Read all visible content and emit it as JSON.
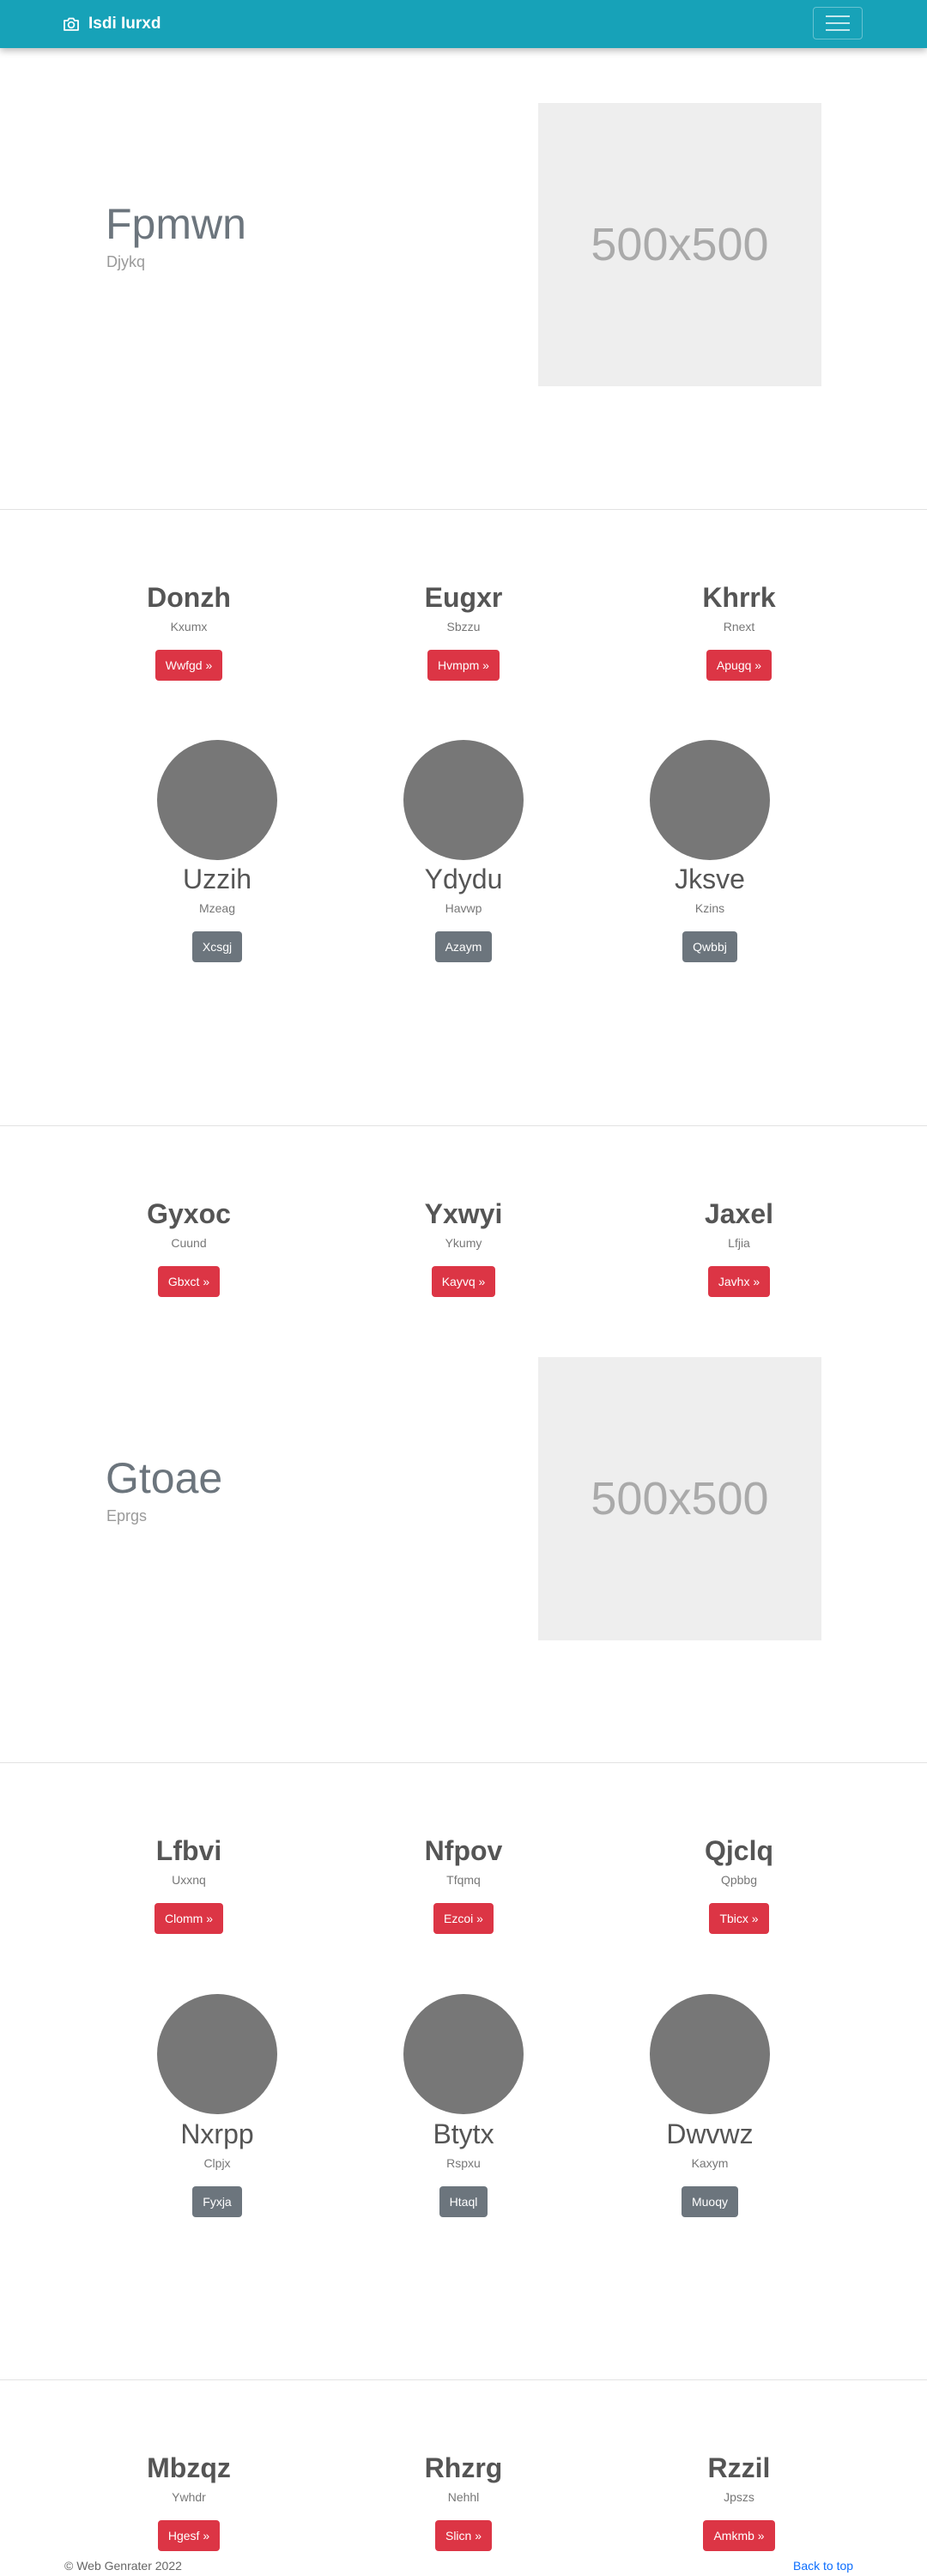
{
  "navbar": {
    "brand": "Isdi Iurxd",
    "brand_icon": "camera-icon",
    "toggler_icon": "hamburger-icon"
  },
  "hero1": {
    "title": "Fpmwn",
    "subtitle": "Djykq",
    "placeholder": "500x500"
  },
  "features1": [
    {
      "title": "Donzh",
      "text": "Kxumx",
      "button": "Wwfgd »"
    },
    {
      "title": "Eugxr",
      "text": "Sbzzu",
      "button": "Hvmpm »"
    },
    {
      "title": "Khrrk",
      "text": "Rnext",
      "button": "Apugq »"
    }
  ],
  "people1": [
    {
      "name": "Uzzih",
      "text": "Mzeag",
      "button": "Xcsgj"
    },
    {
      "name": "Ydydu",
      "text": "Havwp",
      "button": "Azaym"
    },
    {
      "name": "Jksve",
      "text": "Kzins",
      "button": "Qwbbj"
    }
  ],
  "features2": [
    {
      "title": "Gyxoc",
      "text": "Cuund",
      "button": "Gbxct »"
    },
    {
      "title": "Yxwyi",
      "text": "Ykumy",
      "button": "Kayvq »"
    },
    {
      "title": "Jaxel",
      "text": "Lfjia",
      "button": "Javhx »"
    }
  ],
  "hero2": {
    "title": "Gtoae",
    "subtitle": "Eprgs",
    "placeholder": "500x500"
  },
  "features3": [
    {
      "title": "Lfbvi",
      "text": "Uxxnq",
      "button": "Clomm »"
    },
    {
      "title": "Nfpov",
      "text": "Tfqmq",
      "button": "Ezcoi »"
    },
    {
      "title": "Qjclq",
      "text": "Qpbbg",
      "button": "Tbicx »"
    }
  ],
  "people2": [
    {
      "name": "Nxrpp",
      "text": "Clpjx",
      "button": "Fyxja"
    },
    {
      "name": "Btytx",
      "text": "Rspxu",
      "button": "Htaql"
    },
    {
      "name": "Dwvwz",
      "text": "Kaxym",
      "button": "Muoqy"
    }
  ],
  "features4": [
    {
      "title": "Mbzqz",
      "text": "Ywhdr",
      "button": "Hgesf »"
    },
    {
      "title": "Rhzrg",
      "text": "Nehhl",
      "button": "Slicn »"
    },
    {
      "title": "Rzzil",
      "text": "Jpszs",
      "button": "Amkmb »"
    }
  ],
  "footer": {
    "copyright": "© Web Genrater 2022",
    "back_to_top": "Back to top"
  },
  "colors": {
    "navbar": "#17a2b8",
    "danger": "#dc3545",
    "secondary": "#6c757d",
    "placeholder": "#eeeeee",
    "avatar": "#777777"
  }
}
